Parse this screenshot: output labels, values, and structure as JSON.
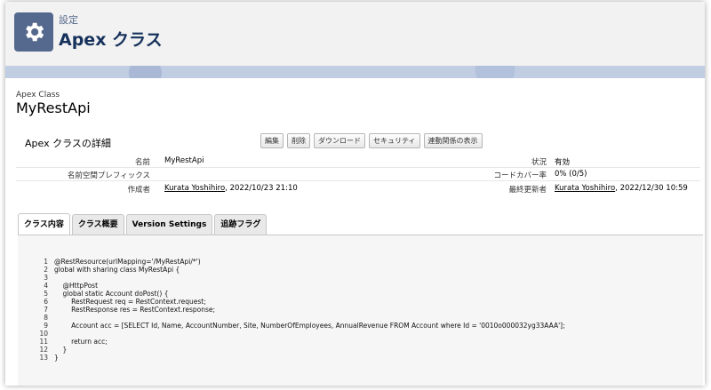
{
  "header": {
    "subtitle": "設定",
    "title": "Apex クラス",
    "icon": "gear-icon"
  },
  "object": {
    "type_label": "Apex Class",
    "name": "MyRestApi"
  },
  "detail": {
    "section_title": "Apex クラスの詳細",
    "buttons": [
      "編集",
      "削除",
      "ダウンロード",
      "セキュリティ",
      "連動関係の表示"
    ],
    "name_label": "名前",
    "name_value": "MyRestApi",
    "status_label": "状況",
    "status_value": "有効",
    "namespace_label": "名前空間プレフィックス",
    "namespace_value": "",
    "coverage_label": "コードカバー率",
    "coverage_value": "0% (0/5)",
    "created_label": "作成者",
    "created_user": "Kurata Yoshihiro",
    "created_date": ", 2022/10/23 21:10",
    "modified_label": "最終更新者",
    "modified_user": "Kurata Yoshihiro",
    "modified_date": ", 2022/12/30 10:59"
  },
  "tabs": [
    "クラス内容",
    "クラス概要",
    "Version Settings",
    "追跡フラグ"
  ],
  "code": {
    "line_numbers": [
      "1",
      "2",
      "3",
      "4",
      "5",
      "6",
      "7",
      "8",
      "9",
      "10",
      "11",
      "12",
      "13"
    ],
    "lines": [
      "@RestResource(urlMapping='/MyRestApi/*')",
      "global with sharing class MyRestApi {",
      "",
      "    @HttpPost",
      "    global static Account doPost() {",
      "        RestRequest req = RestContext.request;",
      "        RestResponse res = RestContext.response;",
      "",
      "        Account acc = [SELECT Id, Name, AccountNumber, Site, NumberOfEmployees, AnnualRevenue FROM Account where Id = '0010o000032yg33AAA'];",
      "",
      "        return acc;",
      "    }",
      "}"
    ]
  },
  "colors": {
    "header_bg": "#f3f2f2",
    "icon_bg": "#54698d",
    "band": "#c1cde2",
    "code_bg": "#f6f6f6"
  }
}
